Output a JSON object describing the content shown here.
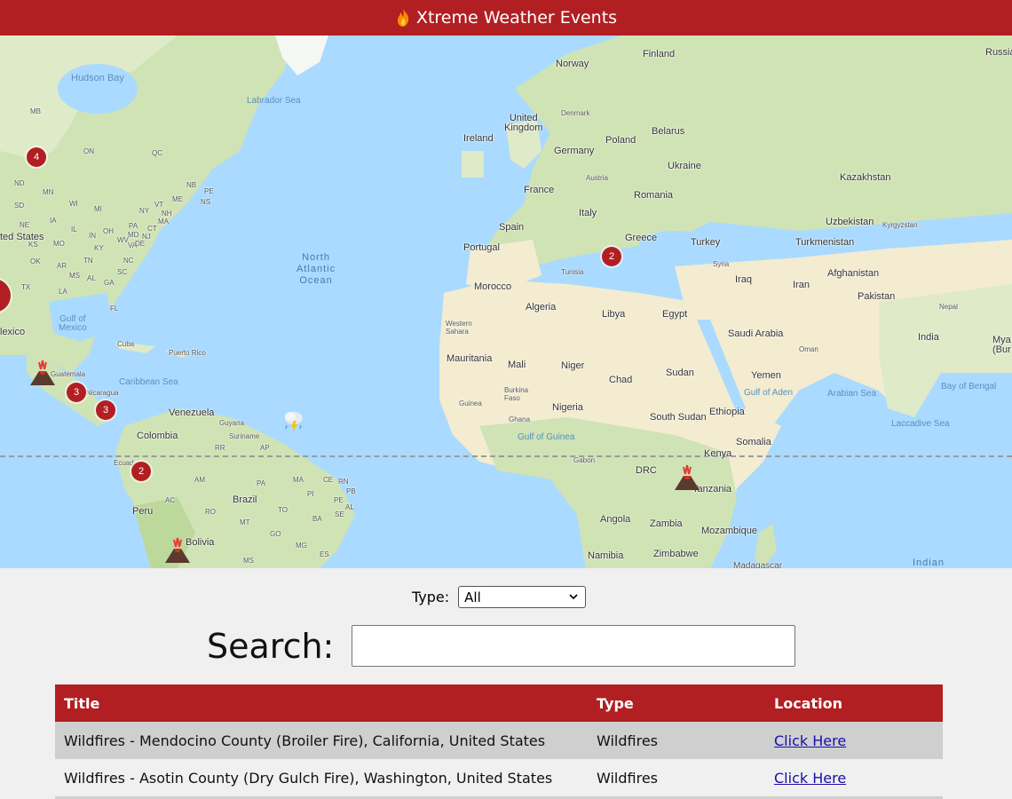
{
  "header": {
    "title": "Xtreme Weather Events",
    "icon": "fire-icon"
  },
  "map": {
    "labels": {
      "hudson_bay": "Hudson Bay",
      "labrador_sea": "Labrador Sea",
      "norway": "Norway",
      "finland": "Finland",
      "russia": "Russia",
      "united_kingdom": "United\nKingdom",
      "denmark": "Denmark",
      "ireland": "Ireland",
      "belarus": "Belarus",
      "poland": "Poland",
      "germany": "Germany",
      "ukraine": "Ukraine",
      "austria": "Austria",
      "france": "France",
      "romania": "Romania",
      "kazakhstan": "Kazakhstan",
      "italy": "Italy",
      "spain": "Spain",
      "greece": "Greece",
      "turkey": "Turkey",
      "uzbekistan": "Uzbekistan",
      "kyrgyzstan": "Kyrgyzstan",
      "turkmenistan": "Turkmenistan",
      "portugal": "Portugal",
      "north_atlantic": "North\nAtlantic\nOcean",
      "tunisia": "Tunisia",
      "syria": "Syria",
      "iraq": "Iraq",
      "iran": "Iran",
      "afghanistan": "Afghanistan",
      "morocco": "Morocco",
      "algeria": "Algeria",
      "libya": "Libya",
      "egypt": "Egypt",
      "pakistan": "Pakistan",
      "nepal": "Nepal",
      "western_sahara": "Western\nSahara",
      "saudi_arabia": "Saudi Arabia",
      "india": "India",
      "oman": "Oman",
      "mauritania": "Mauritania",
      "mali": "Mali",
      "niger": "Niger",
      "chad": "Chad",
      "sudan": "Sudan",
      "yemen": "Yemen",
      "gulf_of_aden": "Gulf of Aden",
      "arabian_sea": "Arabian Sea",
      "bay_of_bengal": "Bay of Bengal",
      "burkina_faso": "Burkina\nFaso",
      "guinea": "Guinea",
      "nigeria": "Nigeria",
      "ghana": "Ghana",
      "south_sudan": "South Sudan",
      "ethiopia": "Ethiopia",
      "laccadive_sea": "Laccadive Sea",
      "gulf_of_guinea": "Gulf of Guinea",
      "somalia": "Somalia",
      "gabon": "Gabon",
      "kenya": "Kenya",
      "drc": "DRC",
      "tanzania": "Tanzania",
      "angola": "Angola",
      "zambia": "Zambia",
      "mozambique": "Mozambique",
      "namibia": "Namibia",
      "zimbabwe": "Zimbabwe",
      "madagascar": "Madagascar",
      "indian": "Indian",
      "mya_bur": "Mya\n(Bur",
      "cuba": "Cuba",
      "puerto_rico": "Puerto Rico",
      "caribbean_sea": "Caribbean Sea",
      "guatemala": "Guatemala",
      "nicaragua": "Nicaragua",
      "venezuela": "Venezuela",
      "guyana": "Guyana",
      "suriname": "Suriname",
      "colombia": "Colombia",
      "ecuador": "Ecuad",
      "peru": "Peru",
      "brazil": "Brazil",
      "bolivia": "Bolivia",
      "united_states": "ted States",
      "mexico": "lexico",
      "gulf_of_mexico": "Gulf of\nMexico",
      "mb": "MB",
      "on": "ON",
      "qc": "QC",
      "nd": "ND",
      "mn": "MN",
      "sd": "SD",
      "wi": "WI",
      "mi": "MI",
      "ne": "NE",
      "ia": "IA",
      "il": "IL",
      "oh": "OH",
      "in": "IN",
      "pa": "PA",
      "ny": "NY",
      "ks": "KS",
      "mo": "MO",
      "ky": "KY",
      "wv": "WV",
      "va": "VA",
      "ok": "OK",
      "ar": "AR",
      "tn": "TN",
      "nc": "NC",
      "ms": "MS",
      "al": "AL",
      "ga": "GA",
      "sc": "SC",
      "tx": "TX",
      "la": "LA",
      "fl": "FL",
      "nb": "NB",
      "pe": "PE",
      "ns": "NS",
      "me": "ME",
      "vt": "VT",
      "nh": "NH",
      "ma": "MA",
      "ct": "CT",
      "nj": "NJ",
      "de": "DE",
      "md": "MD",
      "rr": "RR",
      "ap": "AP",
      "am": "AM",
      "pa_br": "PA",
      "ma_br": "MA",
      "ce": "CE",
      "rn": "RN",
      "pb": "PB",
      "pi": "PI",
      "pe_br": "PE",
      "al_br": "AL",
      "se": "SE",
      "ac": "AC",
      "ro": "RO",
      "to": "TO",
      "ba": "BA",
      "mt": "MT",
      "go": "GO",
      "mg": "MG",
      "es": "ES",
      "ms_br": "MS"
    },
    "clusters": [
      {
        "id": "cluster-north-america",
        "count": "4"
      },
      {
        "id": "cluster-mediterranean",
        "count": "2"
      },
      {
        "id": "cluster-central-america",
        "count": "3"
      },
      {
        "id": "cluster-caribbean",
        "count": "3"
      },
      {
        "id": "cluster-ecuador",
        "count": "2"
      }
    ]
  },
  "filters": {
    "type_label": "Type:",
    "type_value": "All",
    "search_label": "Search:",
    "search_value": ""
  },
  "table": {
    "headers": [
      "Title",
      "Type",
      "Location"
    ],
    "rows": [
      {
        "title": "Wildfires - Mendocino County (Broiler Fire), California, United States",
        "type": "Wildfires",
        "location": "Click Here"
      },
      {
        "title": "Wildfires - Asotin County (Dry Gulch Fire), Washington, United States",
        "type": "Wildfires",
        "location": "Click Here"
      }
    ]
  },
  "colors": {
    "brand_red": "#b21f22",
    "water": "#aadaff",
    "land_green": "#cfe3b5",
    "desert": "#f3ecd0"
  }
}
